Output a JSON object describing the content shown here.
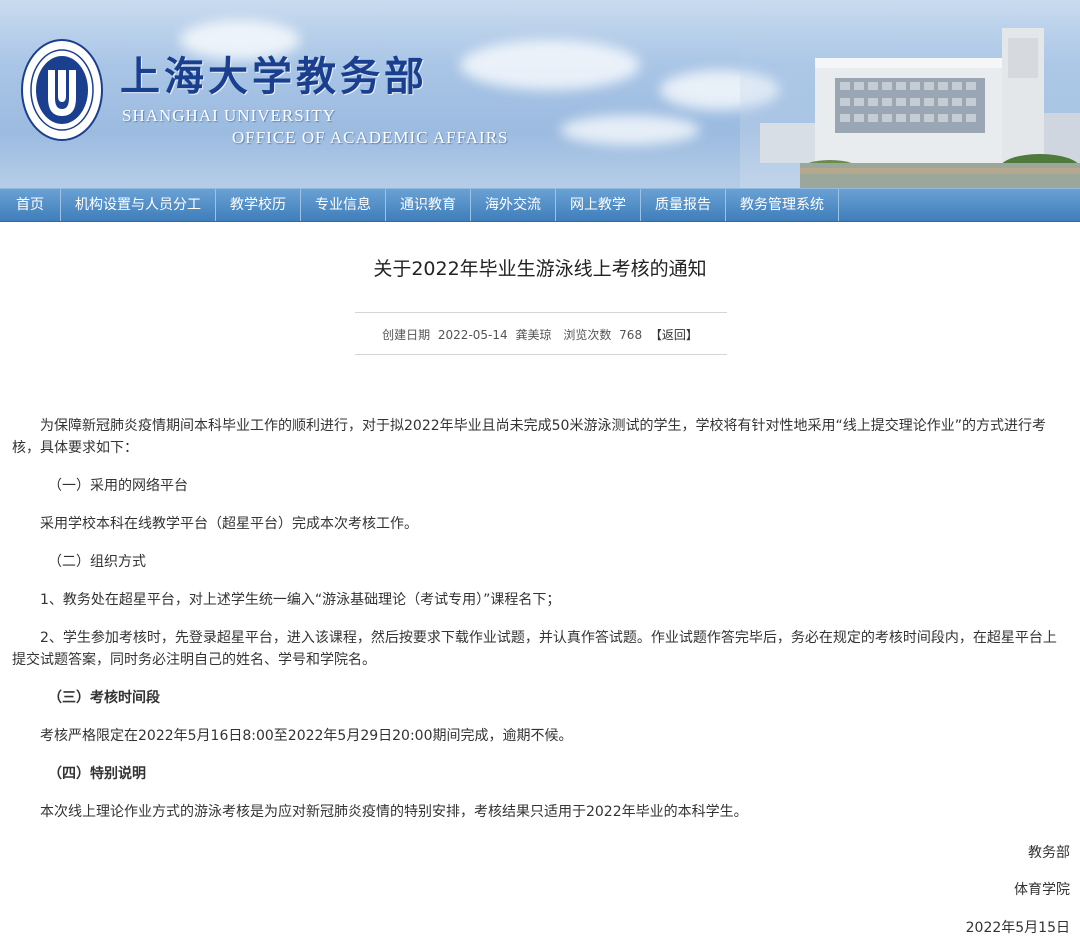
{
  "header": {
    "title_cn": "上海大学教务部",
    "title_en_line1": "SHANGHAI UNIVERSITY",
    "title_en_line2": "OFFICE OF ACADEMIC AFFAIRS",
    "logo_text": "SHANGHAI UNIVERSITY"
  },
  "nav": {
    "items": [
      "首页",
      "机构设置与人员分工",
      "教学校历",
      "专业信息",
      "通识教育",
      "海外交流",
      "网上教学",
      "质量报告",
      "教务管理系统"
    ]
  },
  "article": {
    "title": "关于2022年毕业生游泳线上考核的通知",
    "meta": {
      "created_label": "创建日期",
      "created_date": "2022-05-14",
      "author": "龚美琼",
      "views_label": "浏览次数",
      "views": "768",
      "back_label": "【返回】"
    },
    "paragraphs": {
      "intro": "为保障新冠肺炎疫情期间本科毕业工作的顺利进行，对于拟2022年毕业且尚未完成50米游泳测试的学生，学校将有针对性地采用“线上提交理论作业”的方式进行考核，具体要求如下：",
      "s1_heading": "（一）采用的网络平台",
      "s1_body": "采用学校本科在线教学平台（超星平台）完成本次考核工作。",
      "s2_heading": "（二）组织方式",
      "s2_item1": "1、教务处在超星平台，对上述学生统一编入“游泳基础理论（考试专用）”课程名下；",
      "s2_item2": "2、学生参加考核时，先登录超星平台，进入该课程，然后按要求下载作业试题，并认真作答试题。作业试题作答完毕后，务必在规定的考核时间段内，在超星平台上提交试题答案，同时务必注明自己的姓名、学号和学院名。",
      "s3_heading": "（三）考核时间段",
      "s3_body": "考核严格限定在2022年5月16日8:00至2022年5月29日20:00期间完成，逾期不候。",
      "s4_heading": "（四）特别说明",
      "s4_body": "本次线上理论作业方式的游泳考核是为应对新冠肺炎疫情的特别安排，考核结果只适用于2022年毕业的本科学生。"
    },
    "signature": {
      "dept1": "教务部",
      "dept2": "体育学院",
      "date": "2022年5月15日"
    }
  },
  "colors": {
    "nav_bg": "#3f7ebb",
    "title_blue": "#1b3f8f",
    "text": "#333333"
  }
}
